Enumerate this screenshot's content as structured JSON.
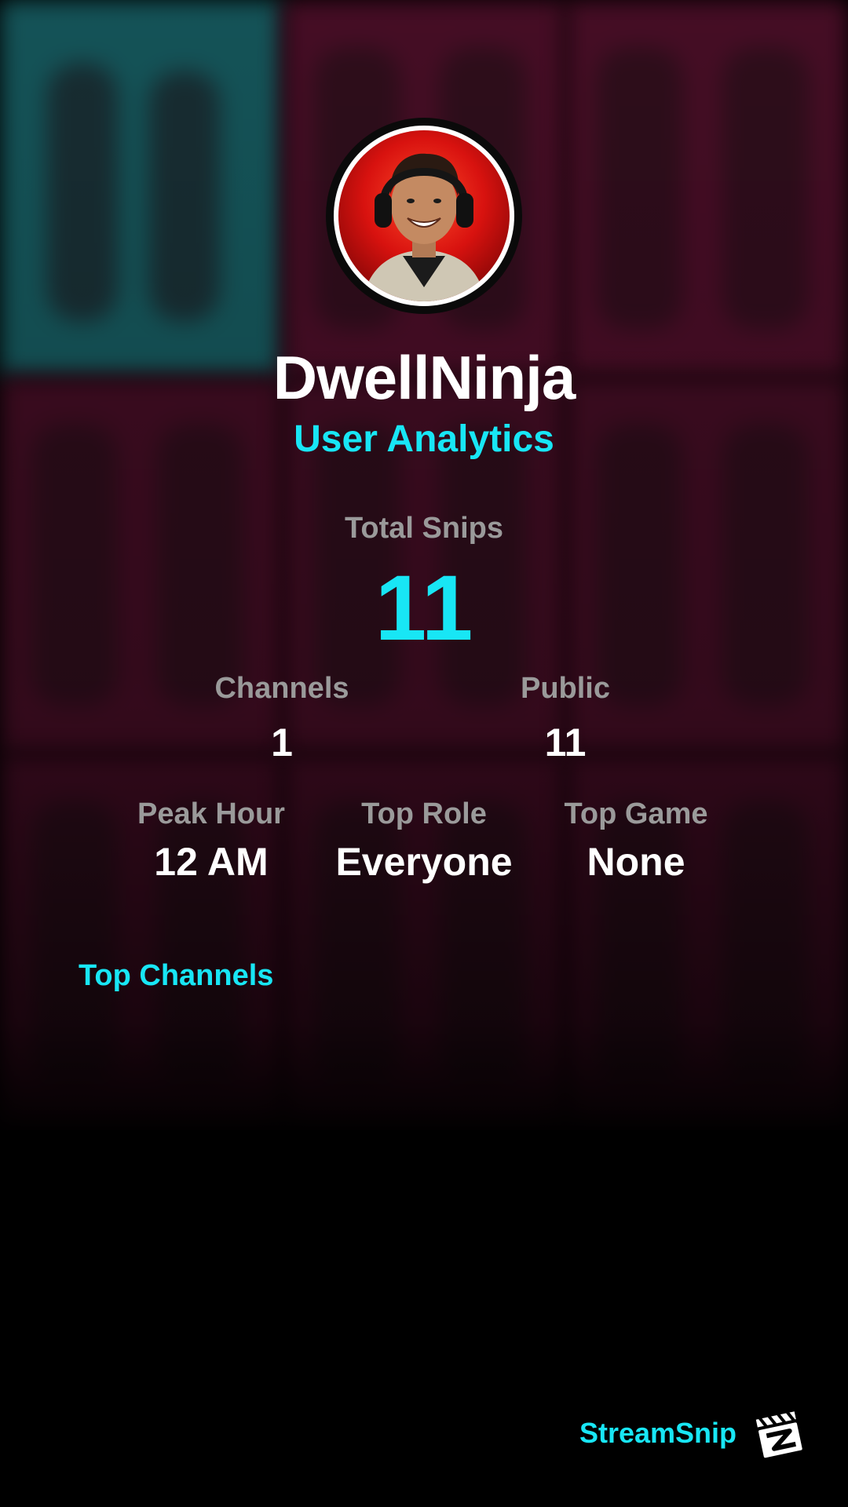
{
  "profile": {
    "username": "DwellNinja",
    "subtitle": "User Analytics",
    "avatar_icon": "avatar-person-headphones"
  },
  "stats": {
    "total_label": "Total Snips",
    "total_value": "11",
    "channels_label": "Channels",
    "channels_value": "1",
    "public_label": "Public",
    "public_value": "11",
    "peak_hour_label": "Peak Hour",
    "peak_hour_value": "12 AM",
    "top_role_label": "Top Role",
    "top_role_value": "Everyone",
    "top_game_label": "Top Game",
    "top_game_value": "None"
  },
  "sections": {
    "top_channels_title": "Top Channels"
  },
  "brand": {
    "name": "StreamSnip",
    "logo_icon": "clapperboard-icon"
  },
  "colors": {
    "accent": "#18e6f5",
    "label": "#9a9a9a",
    "background": "#000000",
    "bg_tint": "#5a1030"
  }
}
